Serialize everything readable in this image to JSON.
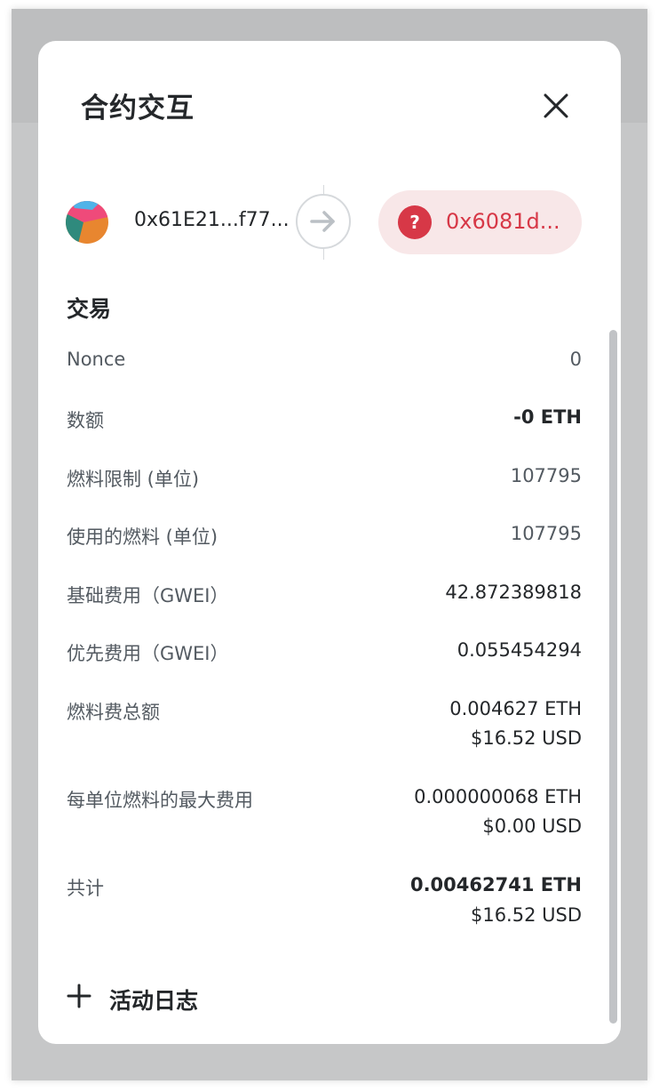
{
  "modal": {
    "title": "合约交互"
  },
  "addresses": {
    "from": "0x61E21...f77...",
    "to": "0x6081d...",
    "to_icon": "question-icon",
    "to_icon_glyph": "?"
  },
  "section": {
    "title": "交易"
  },
  "rows": {
    "nonce": {
      "label": "Nonce",
      "value": "0"
    },
    "amount": {
      "label": "数额",
      "value": "-0 ETH"
    },
    "gas_limit": {
      "label": "燃料限制 (单位)",
      "value": "107795"
    },
    "gas_used": {
      "label": "使用的燃料 (单位)",
      "value": "107795"
    },
    "base_fee": {
      "label": "基础费用（GWEI）",
      "value": "42.872389818"
    },
    "priority_fee": {
      "label": "优先费用（GWEI）",
      "value": "0.055454294"
    },
    "total_gas_fee": {
      "label": "燃料费总额",
      "value": "0.004627 ETH",
      "fiat": "$16.52 USD"
    },
    "max_fee_per_gas": {
      "label": "每单位燃料的最大费用",
      "value": "0.000000068 ETH",
      "fiat": "$0.00 USD"
    },
    "total": {
      "label": "共计",
      "value": "0.00462741 ETH",
      "fiat": "$16.52 USD"
    }
  },
  "activity_log": {
    "label": "活动日志"
  },
  "colors": {
    "danger": "#d73847",
    "danger_bg": "#f8e7e8",
    "text": "#24272a",
    "muted": "#535a61"
  }
}
